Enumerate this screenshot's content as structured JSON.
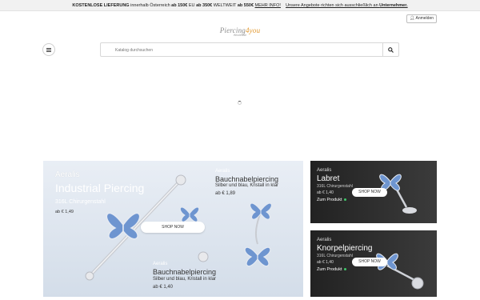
{
  "topbar": {
    "free_label": "KOSTENLOSE LIEFERUNG",
    "text1": " innerhalb Österreich ",
    "val1": "ab 150€",
    "text2": " EU ",
    "val2": "ab 350€",
    "text3": " WELTWEIT ",
    "val3": "ab 550€",
    "more_link": "MEHR INFO!",
    "note_prefix": "Unsere Angebote richten sich ausschließlich an ",
    "note_bold": "Unternehmer."
  },
  "header": {
    "login_label": "Anmelden",
    "logo_part1": "Piercing",
    "logo_part2": "4you",
    "logo_tagline": "Wholesale"
  },
  "search": {
    "placeholder": "Katalog durchsuchen"
  },
  "banners": {
    "main": {
      "brand": "Aeralis",
      "title": "Industrial Piercing",
      "subtitle": "316L Chirurgenstahl",
      "price": "ab € 1,49",
      "shop_label": "SHOP NOW",
      "b2_brand": "Aeralis",
      "b2_title": "Bauchnabelpiercing",
      "b2_sub": "Silber und blau, Kristall in klar",
      "b2_price": "ab € 1,89",
      "b3_brand": "Aeralis",
      "b3_title": "Bauchnabelpiercing",
      "b3_sub": "Silber und blau, Kristall in klar",
      "b3_price": "ab € 1,40"
    },
    "side1": {
      "brand": "Aeralis",
      "title": "Labret",
      "subtitle": "316L Chirurgenstahl",
      "price": "ab € 1,40",
      "shop_label": "SHOP NOW",
      "cta": "Zum Produkt"
    },
    "side2": {
      "brand": "Aeralis",
      "title": "Knorpelpiercing",
      "subtitle": "316L Chirurgenstahl",
      "price": "ab € 1,40",
      "shop_label": "SHOP NOW",
      "cta": "Zum Produkt"
    }
  },
  "icons": {
    "user": "user-icon",
    "menu": "menu-icon",
    "search": "search-icon",
    "loading": "loading-spinner-icon"
  },
  "colors": {
    "accent": "#e29a33",
    "topbar_bg": "#f1f1f1",
    "dark_banner": "#2a2a2a",
    "cta_dot": "#3fc96a"
  }
}
